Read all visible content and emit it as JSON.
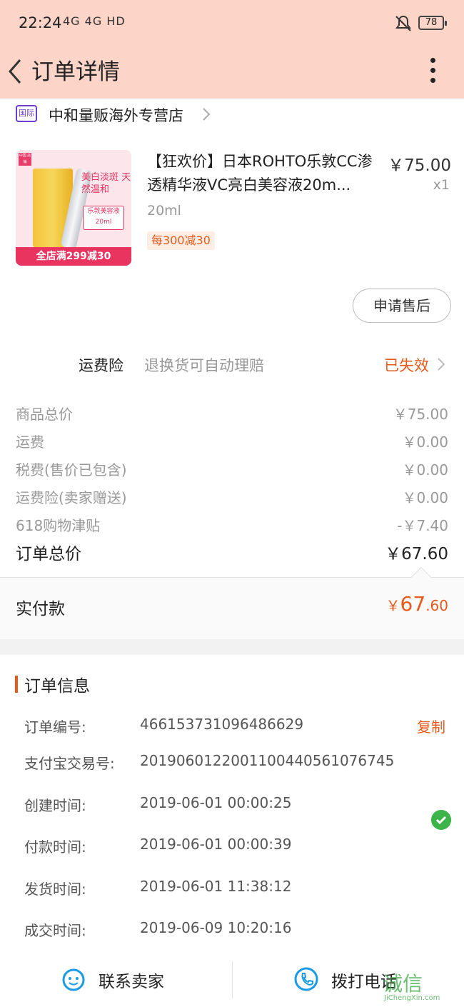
{
  "status_bar": {
    "time": "22:24",
    "network": "4G  4G  HD",
    "battery": "78"
  },
  "nav": {
    "title": "订单详情"
  },
  "shop": {
    "badge": "国际",
    "name": "中和量贩海外专营店"
  },
  "product": {
    "thumb_corner": "中国 店铺",
    "thumb_tag1": "美白淡斑 天然温和",
    "thumb_tag2": "乐敦美容液 20ml",
    "thumb_banner": "全店满299减30",
    "title": "【狂欢价】日本ROHTO乐敦CC渗透精华液VC亮白美容液20m...",
    "spec": "20ml",
    "promo_tag": "每300减30",
    "price": "￥75.00",
    "quantity": "x1"
  },
  "after_sale": {
    "label": "申请售后"
  },
  "insurance": {
    "label": "运费险",
    "description": "退换货可自动理赔",
    "status": "已失效"
  },
  "fees": [
    {
      "label": "商品总价",
      "value": "￥75.00"
    },
    {
      "label": "运费",
      "value": "￥0.00"
    },
    {
      "label": "税费(售价已包含)",
      "value": "￥0.00"
    },
    {
      "label": "运费险(卖家赠送)",
      "value": "￥0.00"
    },
    {
      "label": "618购物津贴",
      "value": "-￥7.40"
    }
  ],
  "order_total": {
    "label": "订单总价",
    "value": "￥67.60"
  },
  "paid": {
    "label": "实付款",
    "currency": "￥",
    "integer": "67",
    "decimal": ".60"
  },
  "order_info": {
    "title": "订单信息",
    "copy_label": "复制",
    "rows": [
      {
        "label": "订单编号:",
        "value": "466153731096486629"
      },
      {
        "label": "支付宝交易号:",
        "value": "2019060122001100440561076745"
      },
      {
        "label": "创建时间:",
        "value": "2019-06-01 00:00:25"
      },
      {
        "label": "付款时间:",
        "value": "2019-06-01 00:00:39"
      },
      {
        "label": "发货时间:",
        "value": "2019-06-01 11:38:12"
      },
      {
        "label": "成交时间:",
        "value": "2019-06-09 10:20:16"
      }
    ]
  },
  "bottom_bar": {
    "contact_seller": "联系卖家",
    "call_phone": "拨打电话"
  },
  "watermark": {
    "cn": "诚信",
    "en": "JiChengXin.com"
  },
  "colors": {
    "header_bg": "#fcd4c8",
    "accent": "#e85a1b",
    "icon_blue": "#1a9be8",
    "check_green": "#3cb44a"
  }
}
